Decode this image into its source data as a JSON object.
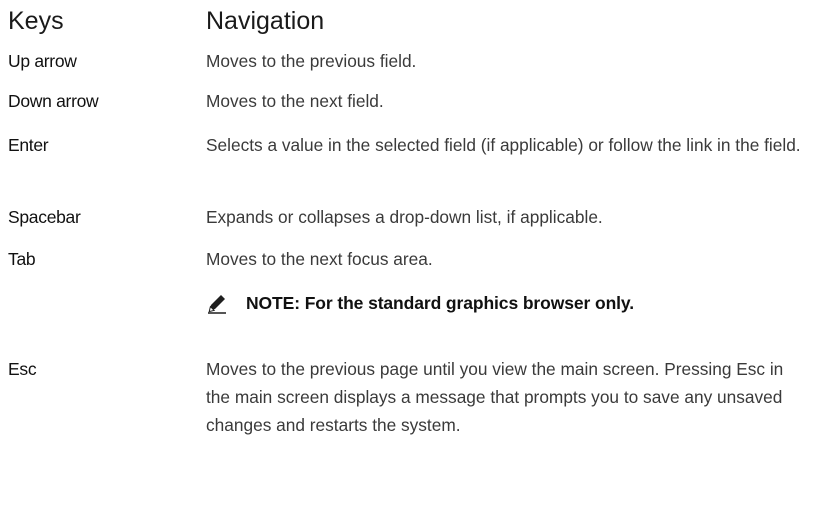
{
  "table": {
    "header": {
      "keys": "Keys",
      "navigation": "Navigation"
    },
    "rows": [
      {
        "key": "Up arrow",
        "description": "Moves to the previous field."
      },
      {
        "key": "Down arrow",
        "description": "Moves to the next field."
      },
      {
        "key": "Enter",
        "description": "Selects a value in the selected field (if applicable) or follow the link in the field."
      },
      {
        "key": "Spacebar",
        "description": "Expands or collapses a drop-down list, if applicable."
      },
      {
        "key": "Tab",
        "description": "Moves to the next focus area."
      },
      {
        "key": "Esc",
        "description": "Moves to the previous page until you view the main screen. Pressing Esc in the main screen displays a message that prompts you to save any unsaved changes and restarts the system."
      }
    ],
    "note": {
      "icon": "pencil-note-icon",
      "text": "NOTE: For the standard graphics browser only."
    }
  }
}
